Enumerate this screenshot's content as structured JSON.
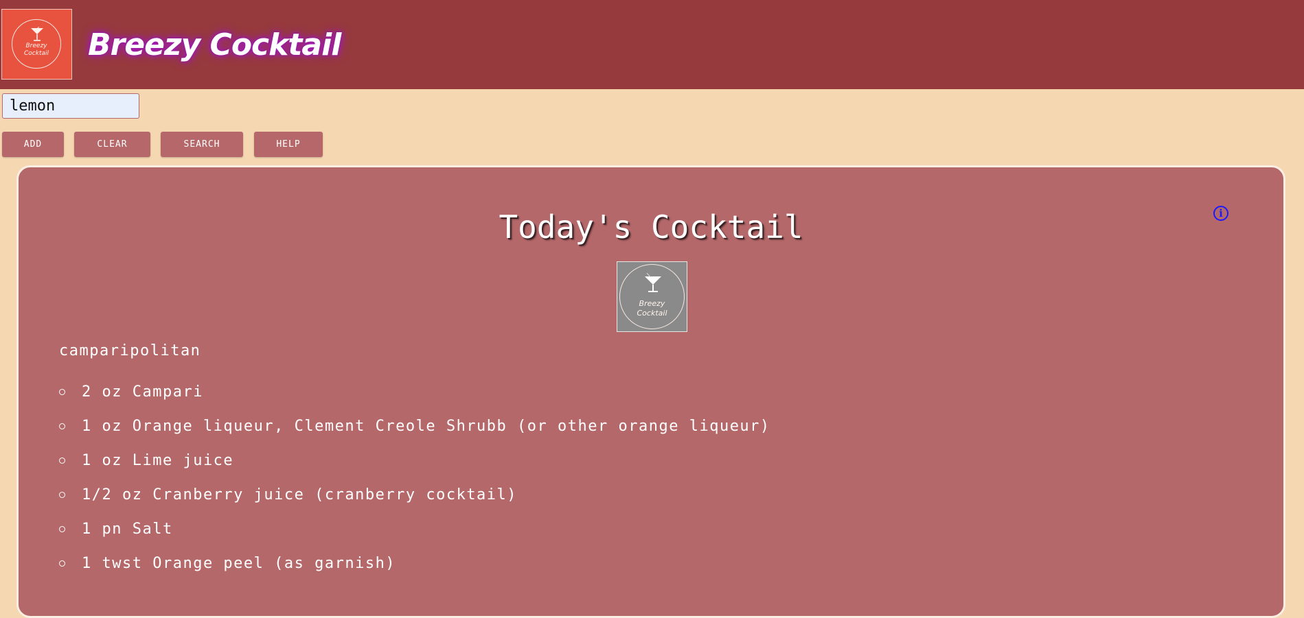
{
  "header": {
    "app_title": "Breezy Cocktail",
    "logo_text_line1": "Breezy",
    "logo_text_line2": "Cocktail"
  },
  "search": {
    "value": "lemon",
    "placeholder": ""
  },
  "toolbar": {
    "add_label": "ADD",
    "clear_label": "CLEAR",
    "search_label": "SEARCH",
    "help_label": "HELP"
  },
  "panel": {
    "title": "Today's Cocktail",
    "info_icon": "info-icon",
    "image_text_line1": "Breezy",
    "image_text_line2": "Cocktail",
    "drink_name": "camparipolitan",
    "ingredients": [
      "2 oz Campari",
      "1 oz Orange liqueur, Clement Creole Shrubb (or other orange liqueur)",
      "1 oz Lime juice",
      "1/2 oz Cranberry juice (cranberry cocktail)",
      "1 pn Salt",
      "1 twst Orange peel (as garnish)"
    ]
  },
  "colors": {
    "header_bg": "#963a3d",
    "page_bg": "#f5d7b1",
    "panel_bg": "#b5686a",
    "button_bg": "#b6676a",
    "logo_bg": "#e8533f",
    "title_glow": "#a21bb8",
    "info_icon": "#1a1aff"
  }
}
